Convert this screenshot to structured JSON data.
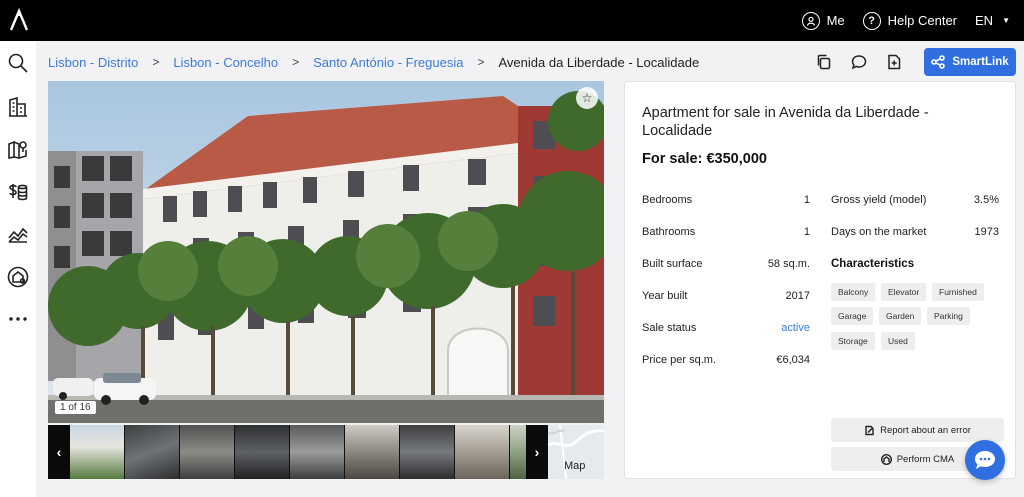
{
  "topbar": {
    "me_label": "Me",
    "help_label": "Help Center",
    "lang_label": "EN"
  },
  "sidebar": {
    "items": [
      "search-icon",
      "building-icon",
      "map-pin-icon",
      "valuation-icon",
      "trend-chart-icon",
      "home-settings-icon",
      "more-icon"
    ]
  },
  "breadcrumb": {
    "items": [
      {
        "label": "Lisbon - Distrito",
        "link": true
      },
      {
        "label": "Lisbon - Concelho",
        "link": true
      },
      {
        "label": "Santo António - Freguesia",
        "link": true
      },
      {
        "label": "Avenida da Liberdade - Localidade",
        "link": false
      }
    ],
    "separator": ">"
  },
  "actions": {
    "smartlink_label": "SmartLink"
  },
  "gallery": {
    "counter": "1 of 16",
    "map_label": "Map"
  },
  "listing": {
    "title": "Apartment for sale in Avenida da Liberdade - Localidade",
    "price": "For sale: €350,000",
    "left_details": [
      {
        "label": "Bedrooms",
        "value": "1"
      },
      {
        "label": "Bathrooms",
        "value": "1"
      },
      {
        "label": "Built surface",
        "value": "58 sq.m."
      },
      {
        "label": "Year built",
        "value": "2017"
      },
      {
        "label": "Sale status",
        "value": "active"
      },
      {
        "label": "Price per sq.m.",
        "value": "€6,034"
      }
    ],
    "right_details": [
      {
        "label": "Gross yield (model)",
        "value": "3.5%"
      },
      {
        "label": "Days on the market",
        "value": "1973"
      }
    ],
    "characteristics_title": "Characteristics",
    "characteristics": [
      "Balcony",
      "Elevator",
      "Furnished",
      "Garage",
      "Garden",
      "Parking",
      "Storage",
      "Used"
    ],
    "report_label": "Report about an error",
    "cma_label": "Perform CMA"
  },
  "colors": {
    "accent": "#2f6fe0",
    "link": "#3d7bd9",
    "topbar": "#000000"
  }
}
